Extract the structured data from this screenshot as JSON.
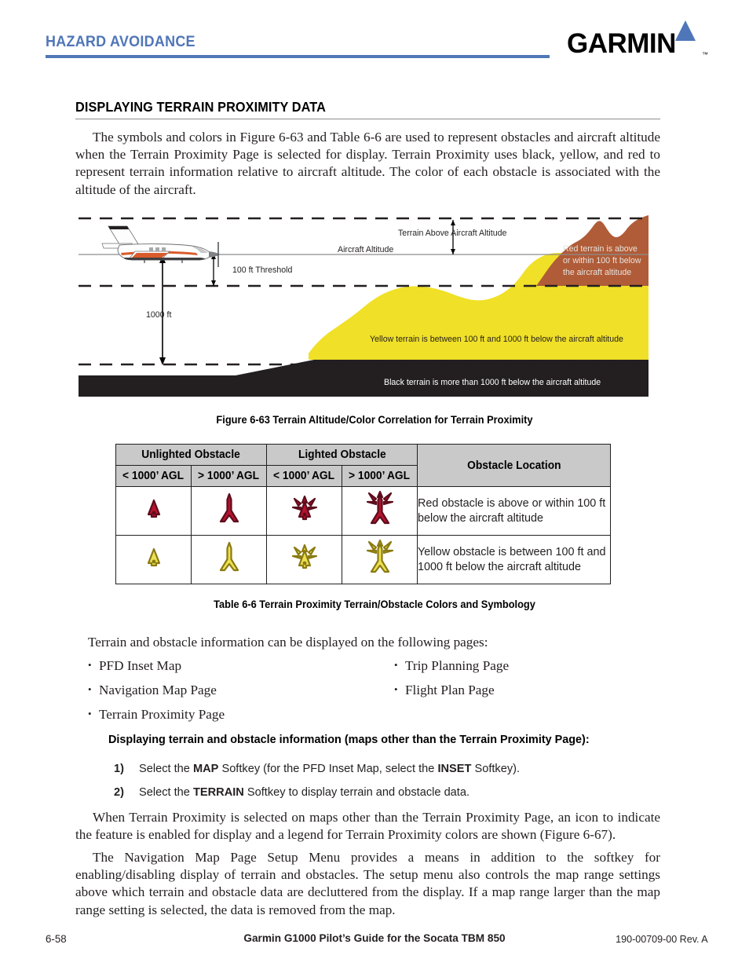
{
  "header": {
    "chapter_title": "HAZARD AVOIDANCE",
    "brand": "GARMIN",
    "brand_tm": "™",
    "accent_color": "#4f76b8"
  },
  "section": {
    "title": "DISPLAYING TERRAIN PROXIMITY DATA",
    "intro_paragraph": "The symbols and colors in Figure 6-63 and Table 6-6 are used to represent obstacles and aircraft altitude when the Terrain Proximity Page is selected for display.  Terrain Proximity uses black, yellow, and red to represent terrain information relative to aircraft altitude.  The color of each obstacle is associated with the altitude of the aircraft."
  },
  "figure": {
    "caption": "Figure 6-63  Terrain Altitude/Color Correlation for Terrain Proximity",
    "labels": {
      "terrain_above": "Terrain Above Aircraft Altitude",
      "aircraft_altitude": "Aircraft Altitude",
      "threshold_100ft": "100 ft Threshold",
      "dim_1000ft": "1000 ft",
      "red_text_line1": "Red terrain is above",
      "red_text_line2": "or within 100 ft below",
      "red_text_line3": "the aircraft altitude",
      "yellow_text": "Yellow terrain is between 100 ft and 1000 ft below the aircraft altitude",
      "black_text": "Black terrain is more than 1000 ft below the aircraft altitude"
    },
    "colors": {
      "red_terrain": "#b05c38",
      "yellow_terrain": "#f0e027",
      "black_terrain": "#231f20"
    }
  },
  "table": {
    "caption": "Table 6-6  Terrain Proximity Terrain/Obstacle Colors and Symbology",
    "group_headers": {
      "unlighted": "Unlighted Obstacle",
      "lighted": "Lighted Obstacle",
      "location": "Obstacle Location"
    },
    "sub_headers": [
      "< 1000’ AGL",
      "> 1000’ AGL",
      "< 1000’ AGL",
      "> 1000’ AGL"
    ],
    "rows": [
      {
        "symbol_color": "#b5122e",
        "symbol_outline": "#5c0d1c",
        "description": "Red obstacle is above or within 100 ft below the aircraft altitude"
      },
      {
        "symbol_color": "#ece053",
        "symbol_outline": "#8a7a12",
        "description": "Yellow obstacle is between 100 ft and 1000 ft below the aircraft altitude"
      }
    ]
  },
  "pages_list": {
    "lead": "Terrain and obstacle information can be displayed on the following pages:",
    "left_column": [
      "PFD Inset Map",
      "Navigation Map Page",
      "Terrain Proximity Page"
    ],
    "right_column": [
      "Trip Planning Page",
      "Flight Plan Page"
    ]
  },
  "procedure": {
    "heading": "Displaying terrain and obstacle information (maps other than the Terrain Proximity Page):",
    "steps": [
      {
        "number": "1)",
        "parts": [
          "Select the ",
          "MAP",
          " Softkey (for the PFD Inset Map, select the ",
          "INSET",
          " Softkey)."
        ]
      },
      {
        "number": "2)",
        "parts": [
          "Select the ",
          "TERRAIN",
          " Softkey to display terrain and obstacle data."
        ]
      }
    ]
  },
  "closing": {
    "paragraph_1": "When Terrain Proximity is selected on maps other than the Terrain Proximity Page, an icon to indicate the feature is enabled for display and a legend for Terrain Proximity colors are shown (Figure 6-67).",
    "paragraph_2": "The Navigation Map Page Setup Menu provides a means in addition to the softkey for enabling/disabling display of terrain and obstacles.  The setup menu also controls the map range settings above which terrain and obstacle data are decluttered from the display.  If a map range larger than the map range setting is selected, the data is removed from the map."
  },
  "footer": {
    "page_number": "6-58",
    "document_title": "Garmin G1000 Pilot’s Guide for the Socata TBM 850",
    "part_number": "190-00709-00  Rev. A"
  }
}
